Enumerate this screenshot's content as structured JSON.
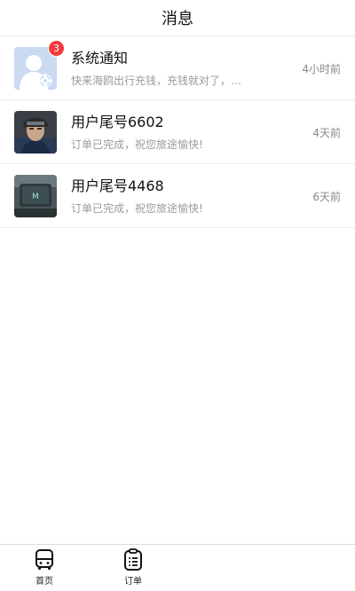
{
  "header": {
    "title": "消息"
  },
  "messages": [
    {
      "name": "系统通知",
      "preview": "快来海鸥出行充钱，充钱就对了，…",
      "time": "4小时前",
      "badge": "3",
      "avatar_icon": "system-user-gear-icon"
    },
    {
      "name": "用户尾号6602",
      "preview": "订单已完成，祝您旅途愉快!",
      "time": "4天前",
      "avatar_icon": "user-photo-avatar"
    },
    {
      "name": "用户尾号4468",
      "preview": "订单已完成，祝您旅途愉快!",
      "time": "6天前",
      "avatar_icon": "user-photo-avatar"
    }
  ],
  "tabbar": {
    "home_label": "首页",
    "order_label": "订单",
    "home_icon": "bus-icon",
    "order_icon": "clipboard-list-icon"
  },
  "colors": {
    "badge": "#f13b3b",
    "system_avatar_bg": "#c9daf1",
    "divider": "#ececec"
  }
}
